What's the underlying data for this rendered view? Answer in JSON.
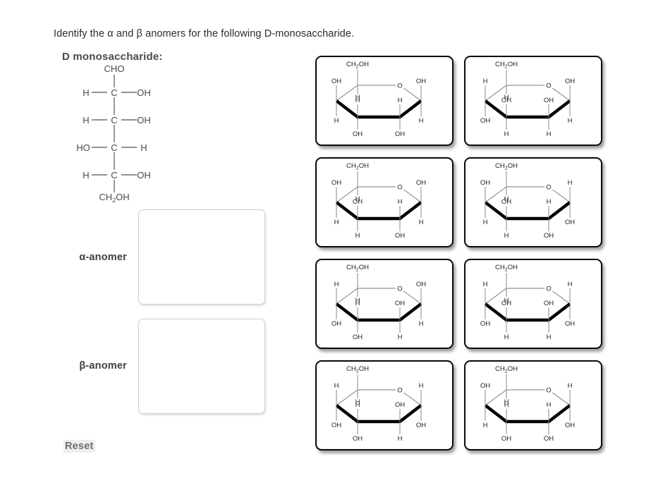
{
  "prompt": "Identify the α and β anomers for the following D-monosaccharide.",
  "left_panel": {
    "heading": "D monosaccharide:",
    "fischer": {
      "top_label": "CHO",
      "bottom_label": "CH",
      "bottom_sub": "2",
      "bottom_label_tail": "OH",
      "center_atom": "C",
      "rows": [
        {
          "left": "H",
          "right": "OH"
        },
        {
          "left": "H",
          "right": "OH"
        },
        {
          "left": "HO",
          "right": "H"
        },
        {
          "left": "H",
          "right": "OH"
        }
      ]
    },
    "dropzones": [
      {
        "id": "alpha",
        "label": "α-anomer",
        "value": ""
      },
      {
        "id": "beta",
        "label": "β-anomer",
        "value": ""
      }
    ],
    "reset_label": "Reset"
  },
  "answer_bank": {
    "ch2oh_label": "CH",
    "ch2oh_sub": "2",
    "ch2oh_tail": "OH",
    "ring_oxygen": "O",
    "cards": [
      {
        "id": "card-1",
        "c5_down": "H",
        "c4_up": "OH",
        "c4_down": "H",
        "c3_up": "H",
        "c3_down": "OH",
        "c2_up": "H",
        "c2_down": "OH",
        "c1_up": "OH",
        "c1_down": "H"
      },
      {
        "id": "card-2",
        "c5_down": "H",
        "c4_up": "H",
        "c4_down": "OH",
        "c3_up": "OH",
        "c3_down": "H",
        "c2_up": "OH",
        "c2_down": "H",
        "c1_up": "OH",
        "c1_down": "H"
      },
      {
        "id": "card-3",
        "c5_down": "H",
        "c4_up": "OH",
        "c4_down": "H",
        "c3_up": "OH",
        "c3_down": "H",
        "c2_up": "H",
        "c2_down": "OH",
        "c1_up": "OH",
        "c1_down": "H"
      },
      {
        "id": "card-4",
        "c5_down": "H",
        "c4_up": "OH",
        "c4_down": "H",
        "c3_up": "OH",
        "c3_down": "H",
        "c2_up": "H",
        "c2_down": "OH",
        "c1_up": "H",
        "c1_down": "OH"
      },
      {
        "id": "card-5",
        "c5_down": "H",
        "c4_up": "H",
        "c4_down": "OH",
        "c3_up": "H",
        "c3_down": "OH",
        "c2_up": "OH",
        "c2_down": "H",
        "c1_up": "OH",
        "c1_down": "H"
      },
      {
        "id": "card-6",
        "c5_down": "H",
        "c4_up": "H",
        "c4_down": "OH",
        "c3_up": "OH",
        "c3_down": "H",
        "c2_up": "OH",
        "c2_down": "H",
        "c1_up": "H",
        "c1_down": "OH"
      },
      {
        "id": "card-7",
        "c5_down": "H",
        "c4_up": "H",
        "c4_down": "OH",
        "c3_up": "H",
        "c3_down": "OH",
        "c2_up": "OH",
        "c2_down": "H",
        "c1_up": "H",
        "c1_down": "OH"
      },
      {
        "id": "card-8",
        "c5_down": "H",
        "c4_up": "OH",
        "c4_down": "H",
        "c3_up": "H",
        "c3_down": "OH",
        "c2_up": "H",
        "c2_down": "OH",
        "c1_up": "H",
        "c1_down": "OH"
      }
    ]
  },
  "colors": {
    "page_background": "#ffffff",
    "text": "#333333",
    "card_border": "#0a0a0a",
    "dropzone_border": "#cfcfcf",
    "reset_text": "#6e6e6e",
    "bond": "#6e6e6e"
  }
}
